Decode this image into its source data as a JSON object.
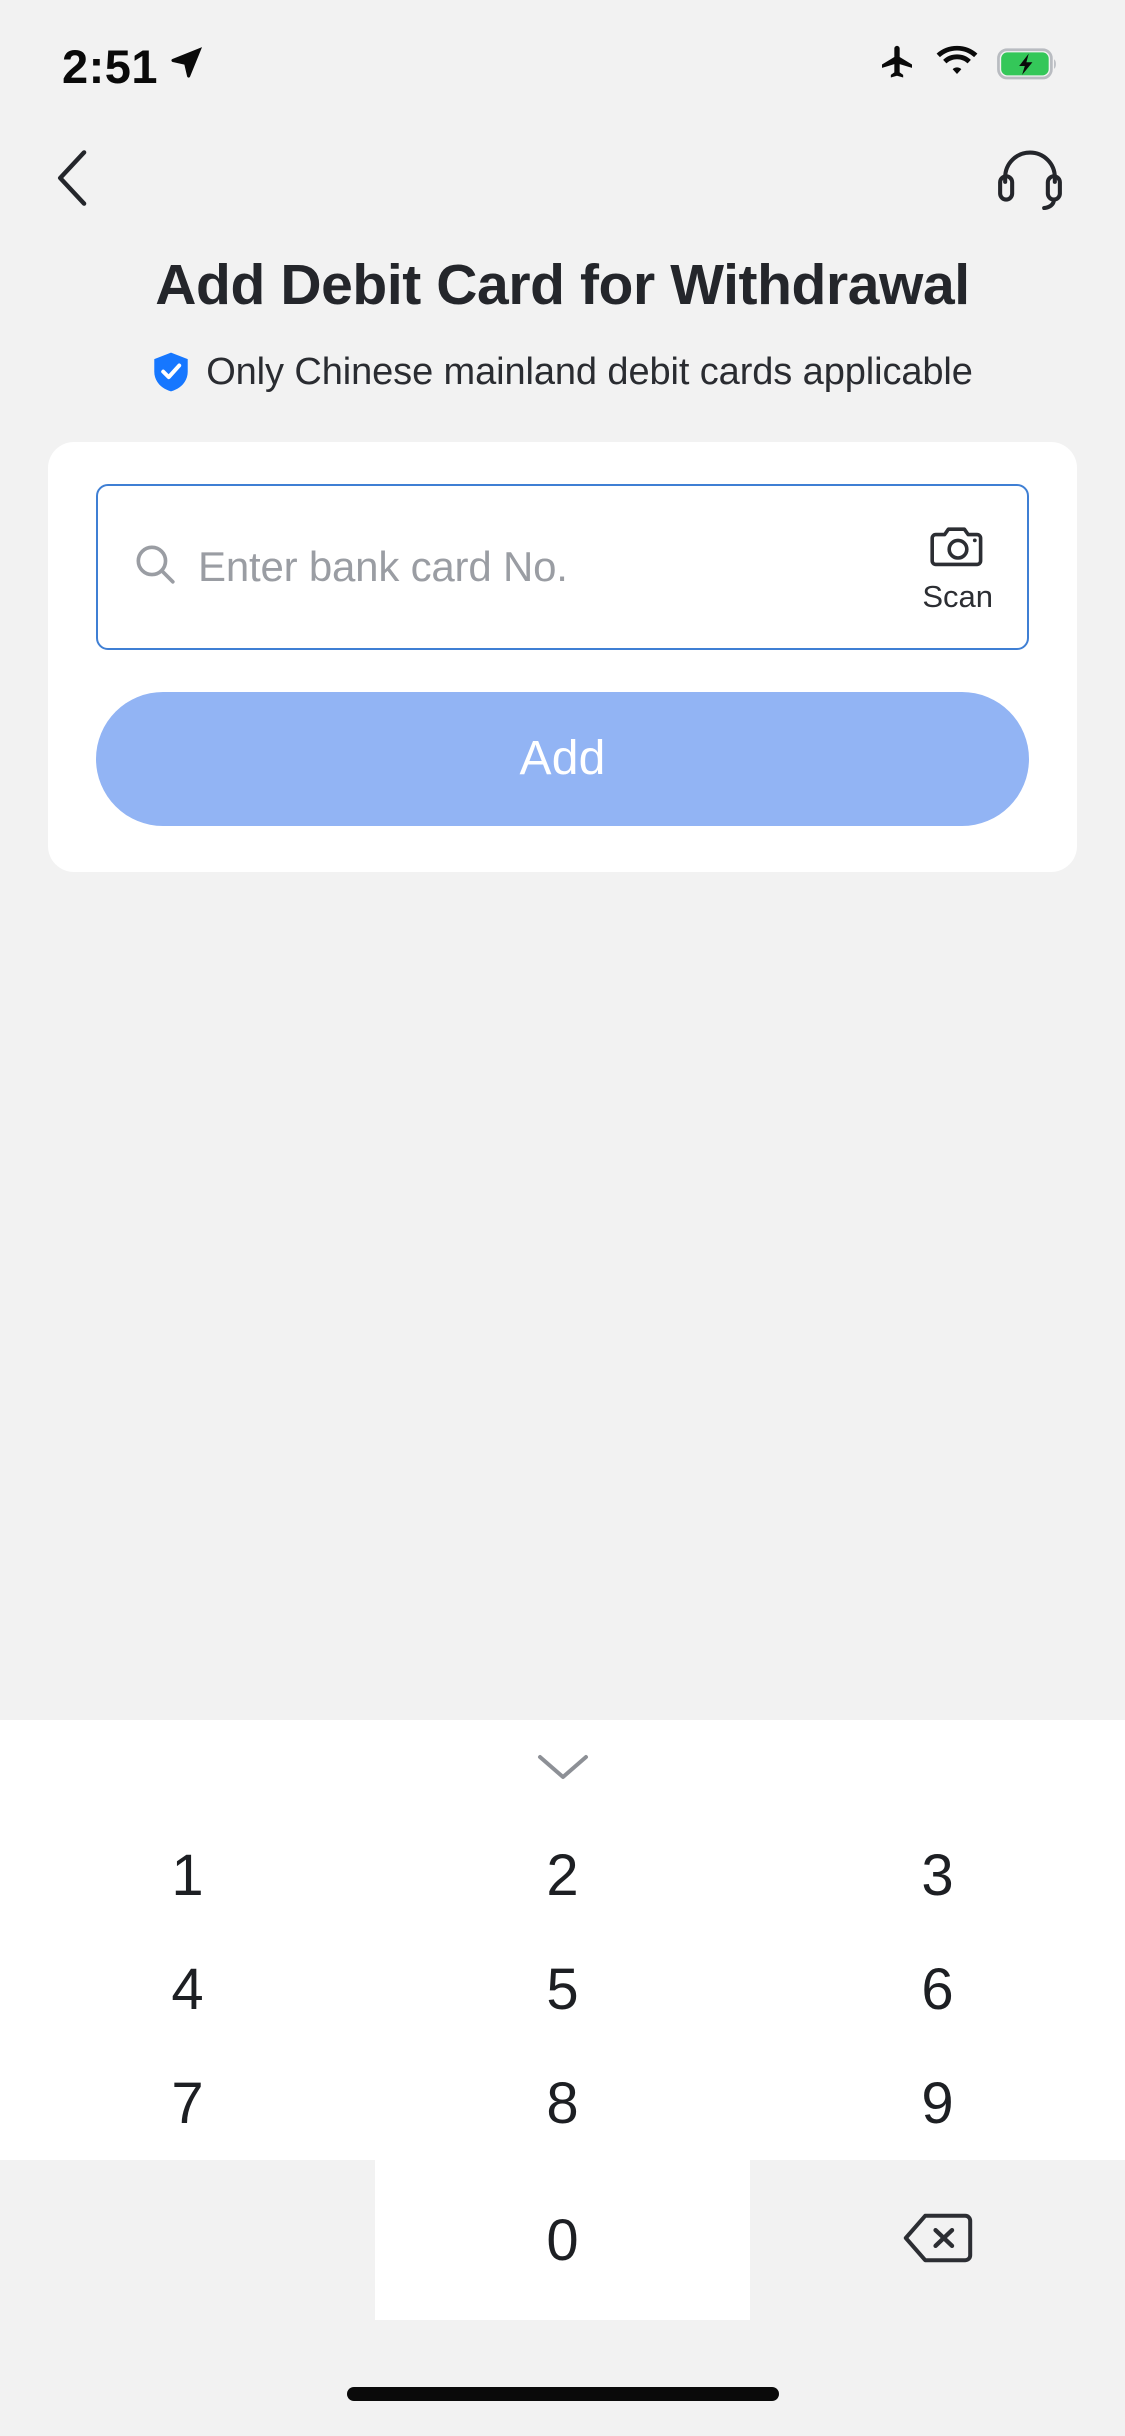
{
  "status_bar": {
    "time": "2:51",
    "location_icon": "location-arrow-icon",
    "airplane_icon": "airplane-mode-icon",
    "wifi_icon": "wifi-icon",
    "battery_icon": "battery-charging-icon",
    "battery_color": "#34c759"
  },
  "nav": {
    "back_icon": "back-chevron-icon",
    "support_icon": "headset-icon"
  },
  "header": {
    "title": "Add Debit Card for Withdrawal",
    "notice_text": "Only Chinese mainland debit cards applicable",
    "notice_badge_icon": "shield-check-icon",
    "notice_badge_color": "#1677ff"
  },
  "form": {
    "search_icon": "search-icon",
    "card_number_value": "",
    "card_number_placeholder": "Enter bank card No.",
    "scan_icon": "camera-icon",
    "scan_label": "Scan",
    "submit_label": "Add",
    "submit_color": "#92b4f4",
    "input_border_color": "#3f7fd4"
  },
  "keypad": {
    "collapse_icon": "chevron-down-icon",
    "keys": [
      "1",
      "2",
      "3",
      "4",
      "5",
      "6",
      "7",
      "8",
      "9"
    ],
    "zero_key": "0",
    "backspace_icon": "backspace-delete-icon"
  },
  "system": {
    "home_indicator": "home-indicator"
  }
}
